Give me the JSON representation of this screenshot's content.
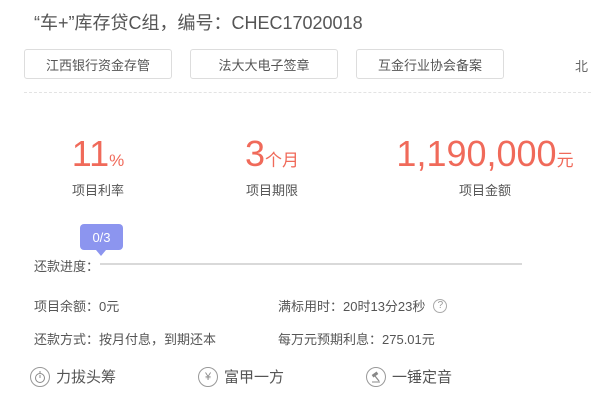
{
  "title": "“车+”库存贷C组，编号：CHEC17020018",
  "tags": [
    "江西银行资金存管",
    "法大大电子签章",
    "互金行业协会备案",
    "北"
  ],
  "stats": [
    {
      "value": "11",
      "unit": "%",
      "label": "项目利率"
    },
    {
      "value": "3",
      "unit": "个月",
      "label": "项目期限"
    },
    {
      "value": "1,190,000",
      "unit": "元",
      "label": "项目金额"
    }
  ],
  "progress": {
    "badge": "0/3",
    "label": "还款进度：",
    "fraction": 0.0
  },
  "info": {
    "remaining": "项目余额：0元",
    "full_time": "满标用时：20时13分23秒",
    "repay_method": "还款方式：按月付息，到期还本",
    "expected_interest": "每万元预期利息：275.01元"
  },
  "badges": [
    {
      "label": "力拔头筹",
      "icon": "stopwatch-icon"
    },
    {
      "label": "富甲一方",
      "icon": "yen-icon"
    },
    {
      "label": "一锤定音",
      "icon": "gavel-icon"
    }
  ]
}
